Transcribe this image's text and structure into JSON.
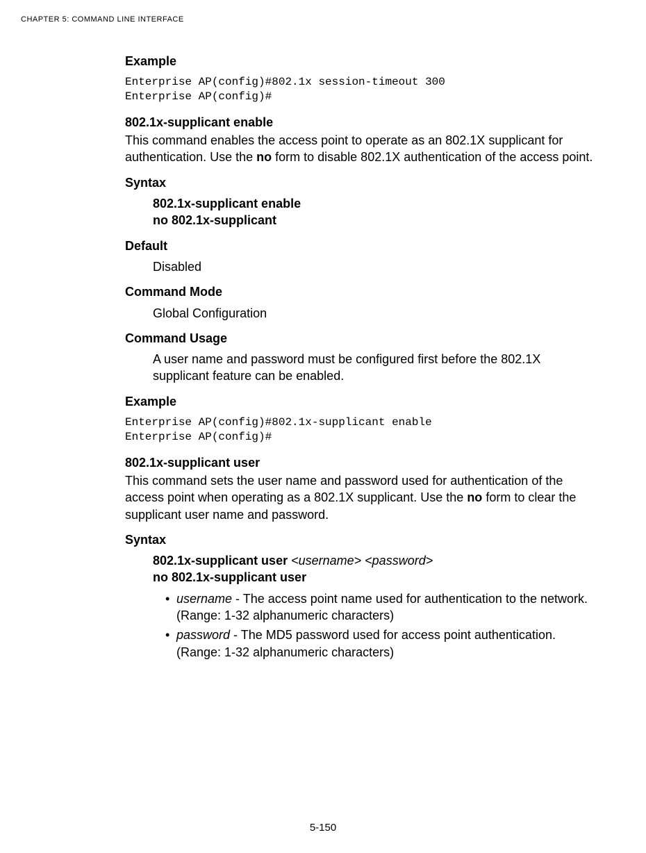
{
  "header": {
    "chapterLabel": "CHAPTER 5: COMMAND LINE INTERFACE"
  },
  "sec1": {
    "heading": "Example",
    "code": "Enterprise AP(config)#802.1x session-timeout 300\nEnterprise AP(config)#"
  },
  "sec2": {
    "title": "802.1x-supplicant enable",
    "descPre": "This command enables the access point to operate as an 802.1X supplicant for authentication. Use the ",
    "descBold": "no",
    "descPost": " form to disable 802.1X authentication of the access point.",
    "syntaxHeading": "Syntax",
    "syntaxLine1": "802.1x-supplicant enable",
    "syntaxLine2": "no 802.1x-supplicant",
    "defaultHeading": "Default",
    "defaultValue": "Disabled",
    "modeHeading": "Command Mode",
    "modeValue": "Global Configuration",
    "usageHeading": "Command Usage",
    "usageText": "A user name and password must be configured first before the 802.1X supplicant feature can be enabled.",
    "exampleHeading": "Example",
    "code": "Enterprise AP(config)#802.1x-supplicant enable\nEnterprise AP(config)#"
  },
  "sec3": {
    "title": "802.1x-supplicant user",
    "descPre": "This command sets the user name and password used for authentication of the access point when operating as a 802.1X supplicant. Use the ",
    "descBold": "no",
    "descPost": " form to clear the supplicant user name and password.",
    "syntaxHeading": "Syntax",
    "syntaxLine1Bold": "802.1x-supplicant user ",
    "syntaxLine1Italic": "<username> <password>",
    "syntaxLine2": "no 802.1x-supplicant user",
    "bullet1Italic": "username",
    "bullet1Rest": " - The access point name used for authentication to the network. (Range: 1-32 alphanumeric characters)",
    "bullet2Italic": "password",
    "bullet2Rest": " - The MD5 password used for access point authentication. (Range: 1-32 alphanumeric characters)"
  },
  "footer": {
    "pageNumber": "5-150"
  }
}
